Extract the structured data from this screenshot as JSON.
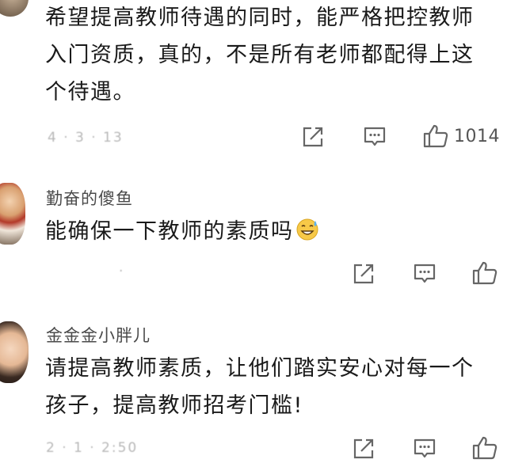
{
  "comments": [
    {
      "username": "",
      "lines": [
        "希望提高教师待遇的同时，能严格把控教师",
        "入门资质，真的，不是所有老师都配得上这",
        "个待遇。"
      ],
      "meta": "4 · 3 · 13",
      "like_count": "1014",
      "avatar_icon": "user-avatar-icon"
    },
    {
      "username": "勤奋的傻鱼",
      "lines": [
        "能确保一下教师的素质吗"
      ],
      "emoji_icon": "sweat-smile-emoji-icon",
      "meta": "·",
      "like_count": "",
      "avatar_icon": "user-avatar-icon"
    },
    {
      "username": "金金金小胖儿",
      "lines": [
        "请提高教师素质，让他们踏实安心对每一个",
        "孩子，提高教师招考门槛!"
      ],
      "meta": "2 · 1 · 2:50",
      "like_count": "",
      "avatar_icon": "user-avatar-icon"
    }
  ],
  "icons": {
    "share": "share-icon",
    "reply": "reply-icon",
    "like": "thumbs-up-icon"
  }
}
